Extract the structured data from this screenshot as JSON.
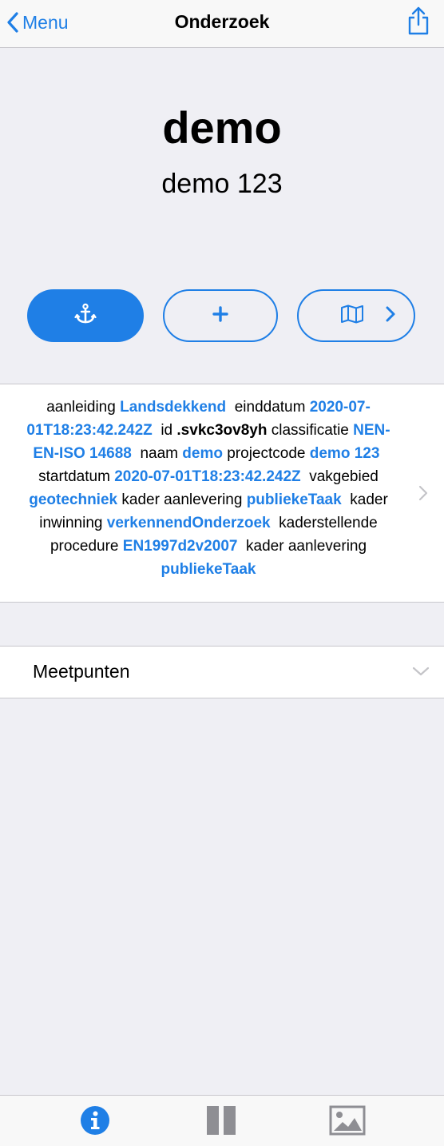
{
  "nav": {
    "back_label": "Menu",
    "title": "Onderzoek"
  },
  "header": {
    "name": "demo",
    "code": "demo 123"
  },
  "info": {
    "aanleiding_key": "aanleiding",
    "aanleiding_val": "Landsdekkend",
    "einddatum_key": "einddatum",
    "einddatum_val": "2020-07-01T18:23:42.242Z",
    "id_key": "id",
    "id_val": ".svkc3ov8yh",
    "classificatie_key": "classificatie",
    "classificatie_val": "NEN-EN-ISO 14688",
    "naam_key": "naam",
    "naam_val": "demo",
    "projectcode_key": "projectcode",
    "projectcode_val": "demo 123",
    "startdatum_key": "startdatum",
    "startdatum_val": "2020-07-01T18:23:42.242Z",
    "vakgebied_key": "vakgebied",
    "vakgebied_val": "geotechniek",
    "kader_aanlevering_key": "kader aanlevering",
    "kader_aanlevering_val": "publiekeTaak",
    "kader_inwinning_key": "kader inwinning",
    "kader_inwinning_val": "verkennendOnderzoek",
    "kaderstellende_key": "kaderstellende procedure",
    "kaderstellende_val": "EN1997d2v2007",
    "kader_aanlevering2_key": "kader aanlevering",
    "kader_aanlevering2_val": "publiekeTaak"
  },
  "section": {
    "label": "Meetpunten"
  },
  "colors": {
    "accent": "#1f7fe6",
    "background": "#efeff4",
    "separator": "#c8c7cc",
    "inactive_icon": "#8e8e93"
  },
  "icons": {
    "back": "chevron-left-icon",
    "share": "share-icon",
    "anchor": "anchor-icon",
    "add": "plus-icon",
    "map": "map-icon",
    "chevron_right": "chevron-right-icon",
    "chevron_down": "chevron-down-icon",
    "tab_info": "info-icon",
    "tab_columns": "columns-icon",
    "tab_image": "image-icon"
  }
}
